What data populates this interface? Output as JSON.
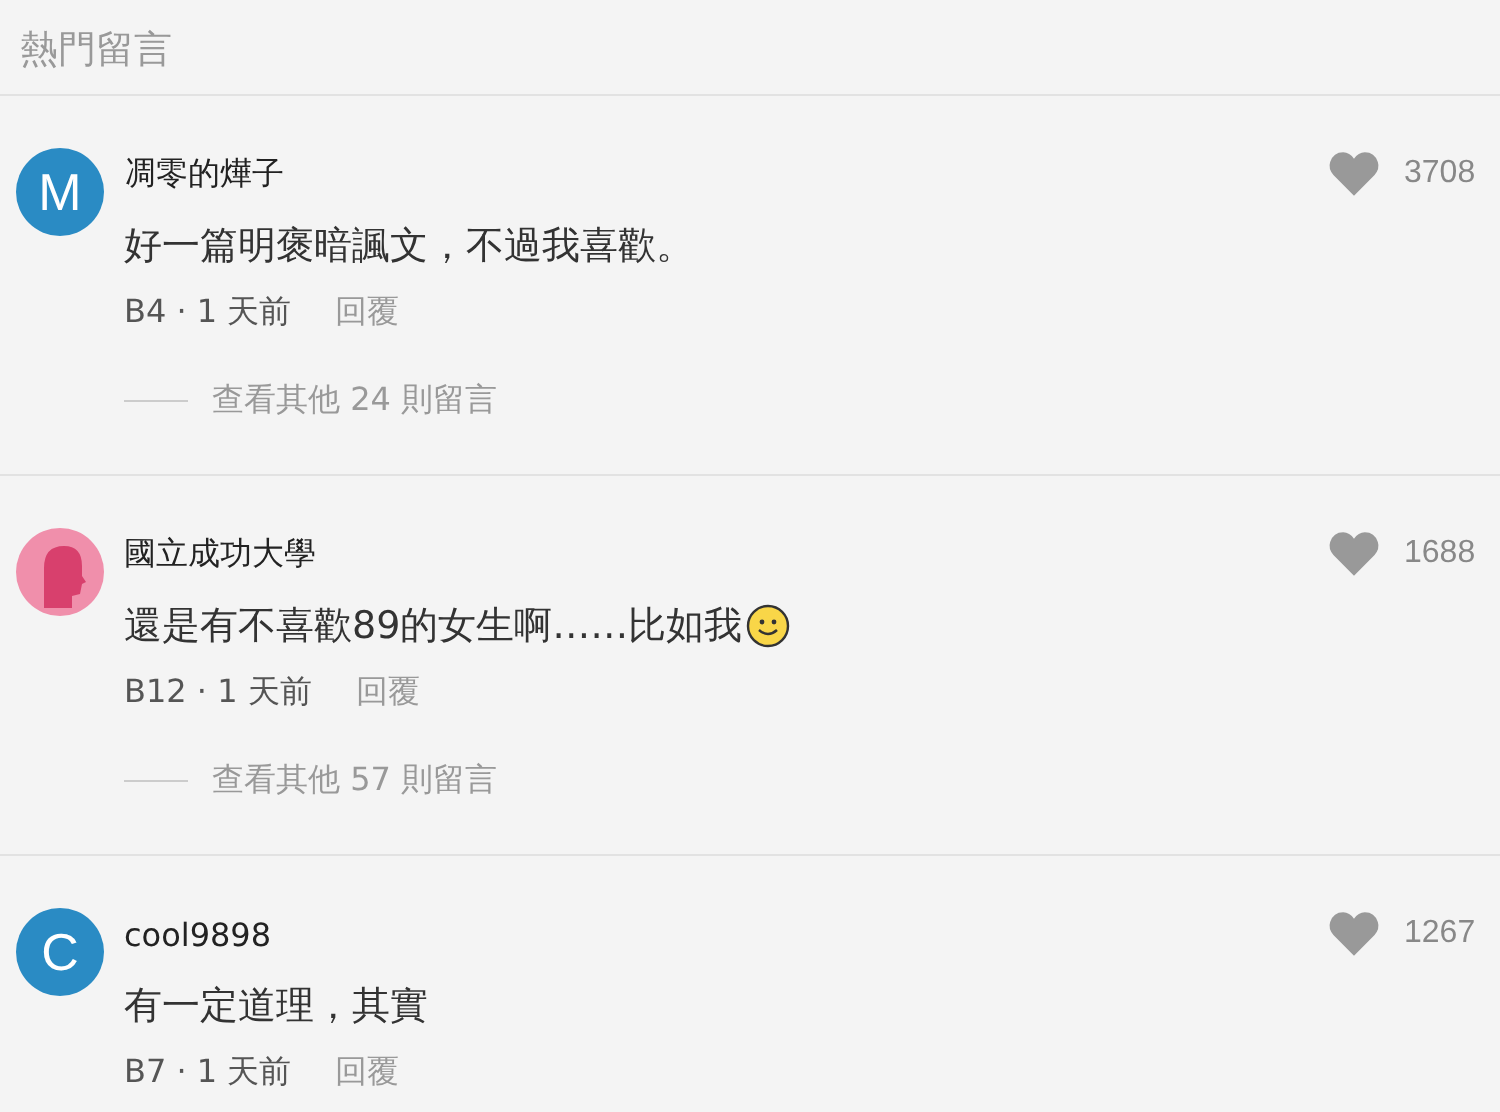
{
  "section_title": "熱門留言",
  "comments": [
    {
      "avatar": {
        "kind": "letter",
        "letter": "M",
        "color": "#2a8bc4"
      },
      "author": "凋零的燁子",
      "body": "好一篇明褒暗諷文，不過我喜歡。",
      "meta": "B4 · 1 天前",
      "reply": "回覆",
      "likes": "3708",
      "more_replies": "查看其他 24 則留言"
    },
    {
      "avatar": {
        "kind": "silhouette",
        "color": "#f08fab"
      },
      "author": "國立成功大學",
      "body": "還是有不喜歡89的女生啊……比如我",
      "trailing_emoji": true,
      "meta": "B12 · 1 天前",
      "reply": "回覆",
      "likes": "1688",
      "more_replies": "查看其他 57 則留言"
    },
    {
      "avatar": {
        "kind": "letter",
        "letter": "C",
        "color": "#2a8bc4"
      },
      "author": "cool9898",
      "body": "有一定道理，其實",
      "meta": "B7 · 1 天前",
      "reply": "回覆",
      "likes": "1267"
    }
  ]
}
